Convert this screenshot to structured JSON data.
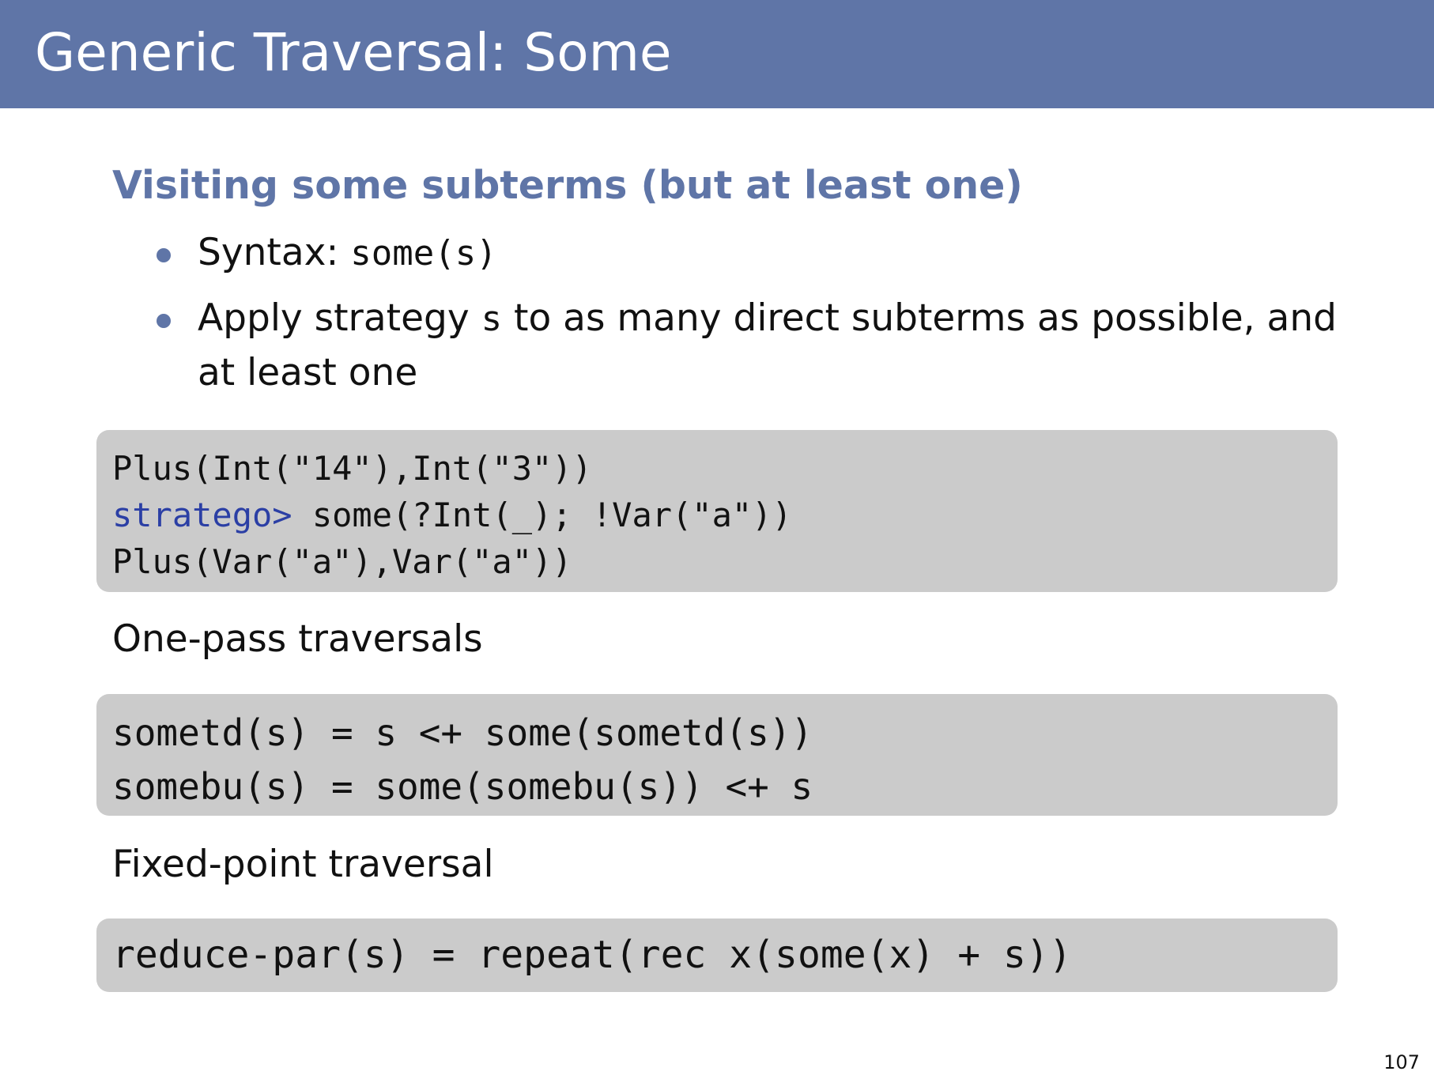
{
  "slide": {
    "title": "Generic Traversal: Some",
    "heading": "Visiting some subterms (but at least one)",
    "bullets": {
      "syntax_label": "Syntax: ",
      "syntax_code": "some(s)",
      "apply_pre": "Apply strategy ",
      "apply_code": "s",
      "apply_post": " to as many direct subterms as possible, and at least one"
    },
    "example": {
      "line1": "Plus(Int(\"14\"),Int(\"3\"))",
      "prompt": "stratego>",
      "command": " some(?Int(_); !Var(\"a\"))",
      "line3": "Plus(Var(\"a\"),Var(\"a\"))"
    },
    "one_pass_label": "One-pass traversals",
    "one_pass_code": {
      "line1": "sometd(s) = s <+ some(sometd(s))",
      "line2": "somebu(s) = some(somebu(s)) <+ s"
    },
    "fixed_point_label": "Fixed-point traversal",
    "fixed_point_code": "reduce-par(s) = repeat(rec x(some(x) + s))",
    "page_number": "107"
  },
  "colors": {
    "title_bar": "#5f75a7",
    "heading": "#5f75a7",
    "code_background": "#cbcbcb",
    "prompt": "#2b3fa5"
  }
}
